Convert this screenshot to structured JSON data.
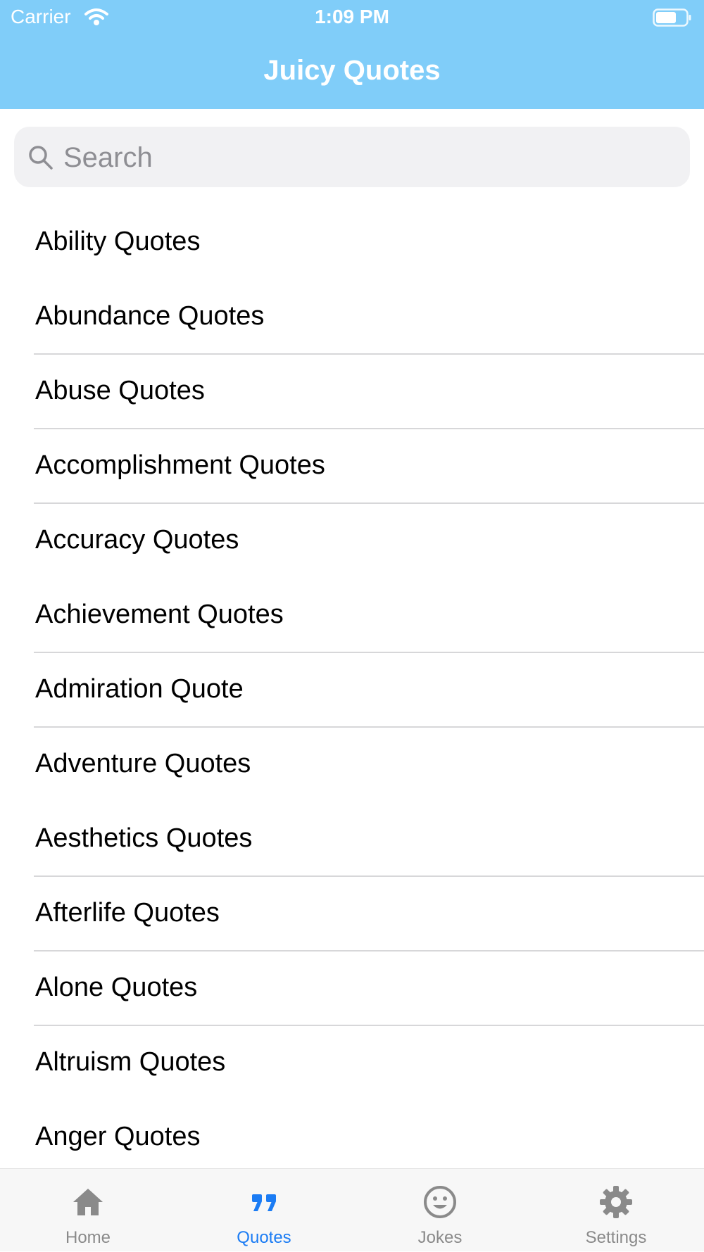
{
  "status_bar": {
    "carrier": "Carrier",
    "time": "1:09 PM",
    "wifi_icon": "wifi-icon",
    "battery_icon": "battery-icon"
  },
  "nav": {
    "title": "Juicy Quotes"
  },
  "search": {
    "placeholder": "Search",
    "icon": "search-icon"
  },
  "list": {
    "items": [
      {
        "label": "Ability Quotes"
      },
      {
        "label": "Abundance Quotes"
      },
      {
        "label": "Abuse Quotes"
      },
      {
        "label": "Accomplishment Quotes"
      },
      {
        "label": "Accuracy Quotes"
      },
      {
        "label": "Achievement Quotes"
      },
      {
        "label": "Admiration Quote"
      },
      {
        "label": "Adventure Quotes"
      },
      {
        "label": "Aesthetics Quotes"
      },
      {
        "label": "Afterlife Quotes"
      },
      {
        "label": "Alone Quotes"
      },
      {
        "label": "Altruism Quotes"
      },
      {
        "label": "Anger Quotes"
      }
    ]
  },
  "tab_bar": {
    "selected": "Quotes",
    "tabs": [
      {
        "label": "Home",
        "icon": "home-icon"
      },
      {
        "label": "Quotes",
        "icon": "quote-icon"
      },
      {
        "label": "Jokes",
        "icon": "smiley-icon"
      },
      {
        "label": "Settings",
        "icon": "gear-icon"
      }
    ]
  },
  "colors": {
    "header": "#80cdf9",
    "active_tab": "#1b7cf4",
    "inactive_tab": "#8a8a8a",
    "search_bg": "#f1f1f3"
  }
}
